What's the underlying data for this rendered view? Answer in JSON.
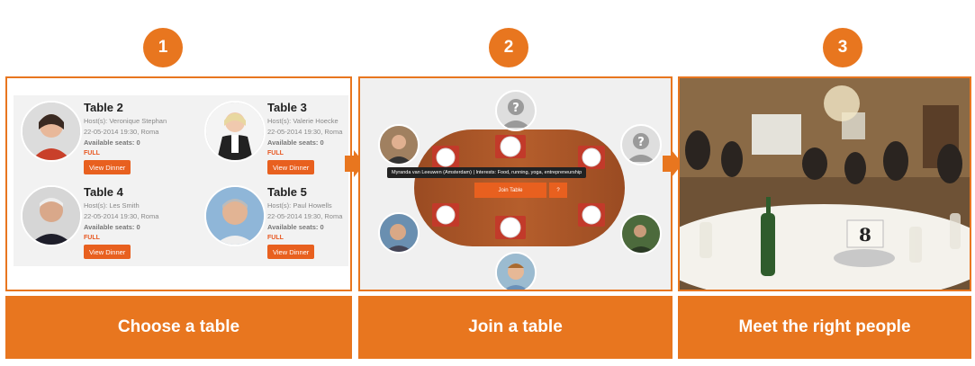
{
  "steps": [
    {
      "number": "1",
      "label": "Choose a table"
    },
    {
      "number": "2",
      "label": "Join a table"
    },
    {
      "number": "3",
      "label": "Meet the right people"
    }
  ],
  "colors": {
    "accent": "#e8761f",
    "button": "#e8601f"
  },
  "tables": [
    {
      "name": "Table 2",
      "hosts": "Host(s): Veronique Stephan",
      "when": "22-05-2014 19:30, Roma",
      "seats": "Available seats: 0",
      "status": "FULL",
      "button": "View Dinner"
    },
    {
      "name": "Table 3",
      "hosts": "Host(s): Valerie Hoecke",
      "when": "22-05-2014 19:30, Roma",
      "seats": "Available seats: 0",
      "status": "FULL",
      "button": "View Dinner"
    },
    {
      "name": "Table 4",
      "hosts": "Host(s): Les Smith",
      "when": "22-05-2014 19:30, Roma",
      "seats": "Available seats: 0",
      "status": "FULL",
      "button": "View Dinner"
    },
    {
      "name": "Table 5",
      "hosts": "Host(s): Paul Howells",
      "when": "22-05-2014 19:30, Roma",
      "seats": "Available seats: 0",
      "status": "FULL",
      "button": "View Dinner"
    }
  ],
  "join": {
    "tooltip": "Myranda van Leeuwen (Amsterdam) | Interests: Food, running, yoga, entrepreneurship",
    "join_button": "Join Table",
    "help_button": "?",
    "empty_seat_icon": "?"
  },
  "photo": {
    "table_number": "8"
  }
}
